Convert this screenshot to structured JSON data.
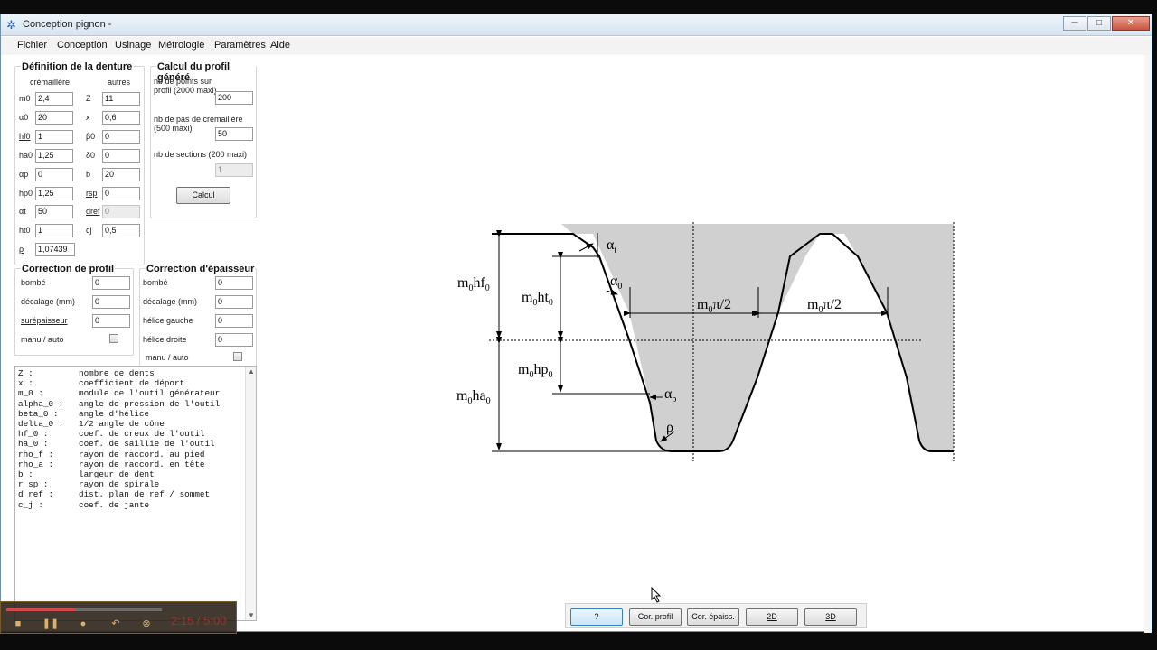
{
  "window": {
    "title": "Conception pignon -",
    "minimize": "─",
    "maximize": "□",
    "close": "✕"
  },
  "menu": [
    "Fichier",
    "Conception",
    "Usinage",
    "Métrologie",
    "Paramètres",
    "Aide"
  ],
  "denture": {
    "title": "Définition de la denture",
    "col1": "crémaillère",
    "col2": "autres",
    "left": [
      {
        "label": "m0",
        "value": "2,4"
      },
      {
        "label": "α0",
        "value": "20"
      },
      {
        "label": "hf0",
        "value": "1"
      },
      {
        "label": "ha0",
        "value": "1,25"
      },
      {
        "label": "αp",
        "value": "0"
      },
      {
        "label": "hp0",
        "value": "1,25"
      },
      {
        "label": "αt",
        "value": "50"
      },
      {
        "label": "ht0",
        "value": "1"
      },
      {
        "label": "ρ",
        "value": "1,07439"
      }
    ],
    "right": [
      {
        "label": "Z",
        "value": "11"
      },
      {
        "label": "x",
        "value": "0,6"
      },
      {
        "label": "β0",
        "value": "0"
      },
      {
        "label": "δ0",
        "value": "0"
      },
      {
        "label": "b",
        "value": "20"
      },
      {
        "label": "rsp",
        "value": "0"
      },
      {
        "label": "dref",
        "value": "0"
      },
      {
        "label": "cj",
        "value": "0,5"
      }
    ]
  },
  "calcul": {
    "title": "Calcul du profil généré",
    "points_label": "nb de points sur profil (2000 maxi)",
    "points_value": "200",
    "pas_label": "nb de pas de crémaillère (500 maxi)",
    "pas_value": "50",
    "sections_label": "nb de sections (200 maxi)",
    "sections_value": "1",
    "button": "Calcul"
  },
  "corr_profil": {
    "title": "Correction de profil",
    "rows": [
      {
        "label": "bombé",
        "value": "0"
      },
      {
        "label": "décalage (mm)",
        "value": "0"
      },
      {
        "label": "surépaisseur",
        "value": "0"
      }
    ],
    "manu": "manu / auto"
  },
  "corr_epaisseur": {
    "title": "Correction d'épaisseur",
    "rows": [
      {
        "label": "bombé",
        "value": "0"
      },
      {
        "label": "décalage (mm)",
        "value": "0"
      },
      {
        "label": "hélice gauche",
        "value": "0"
      },
      {
        "label": "hélice droite",
        "value": "0"
      }
    ],
    "manu": "manu / auto"
  },
  "glossary": [
    {
      "k": "Z :",
      "v": "nombre de dents"
    },
    {
      "k": "x :",
      "v": "coefficient de déport"
    },
    {
      "k": "m_0 :",
      "v": "module de l'outil générateur"
    },
    {
      "k": "alpha_0 :",
      "v": "angle de pression de l'outil"
    },
    {
      "k": "beta_0 :",
      "v": "angle d'hélice"
    },
    {
      "k": "delta_0 :",
      "v": "1/2 angle de cône"
    },
    {
      "k": "hf_0 :",
      "v": "coef. de creux de l'outil"
    },
    {
      "k": "ha_0 :",
      "v": "coef. de saillie de l'outil"
    },
    {
      "k": "rho_f :",
      "v": "rayon de raccord. au pied"
    },
    {
      "k": "rho_a :",
      "v": "rayon de raccord. en tête"
    },
    {
      "k": "b :",
      "v": "largeur de dent"
    },
    {
      "k": "r_sp :",
      "v": "rayon de spirale"
    },
    {
      "k": "d_ref :",
      "v": "dist. plan de ref / sommet"
    },
    {
      "k": "c_j :",
      "v": "coef. de jante"
    }
  ],
  "diagram": {
    "m0hf0": "m",
    "hf": "hf",
    "sub0": "0",
    "alpha": "α",
    "t": "t",
    "p": "p",
    "rho": "ρ",
    "ht": "ht",
    "hp": "hp",
    "ha": "ha",
    "pi2": "π/2"
  },
  "buttons": [
    "?",
    "Cor. profil",
    "Cor. épaiss.",
    "2D",
    "3D"
  ],
  "recorder": {
    "time": "2:15 / 5:00",
    "progress": 0.45
  },
  "colors": {
    "tooth_fill": "#d0d0d0",
    "accent": "#3c7fb1"
  }
}
